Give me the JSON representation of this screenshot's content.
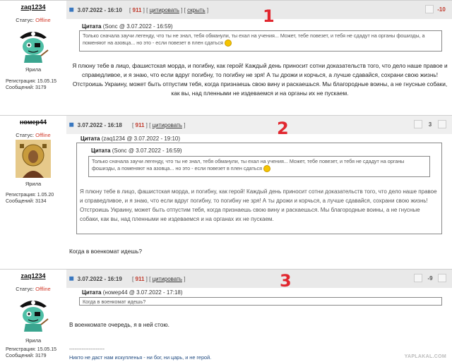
{
  "posts": [
    {
      "username": "zaq1234",
      "status_label": "Статус:",
      "status_value": "Offline",
      "rank": "Ярила",
      "reg": "Регистрация: 15.05.15",
      "msgs": "Сообщений: 3179",
      "date": "3.07.2022 - 16:10",
      "num": "911",
      "quote_link": "цитировать",
      "hide_link": "скрыть",
      "rating": "-10",
      "marker": "1",
      "quote_head_label": "Цитата",
      "quote_head_meta": "(Sonc @ 3.07.2022 - 16:59)",
      "quote_text": "Только сначала заучи легенду, что ты не знал, тебя обманули, ты ехал на учения... Может, тебе повезет, и тебя не сдадут на органы фошизды, а поменяют на азовца... но это - если повезет в плен сдаться",
      "body": "Я плюну тебе в лицо, фашистская морда, и погибну, как герой! Каждый день приносит сотни доказательств того, что дело наше правое и справедливое, и я знаю, что если вдруг погибну, то погибну не зря! А ты дрожи и корчься, а лучше сдавайся, сохрани свою жизнь! Отстроишь Украину, может быть отпустим тебя, когда признаешь свою вину и раскаешься. Мы благородные воины, а не гнусные собаки, как вы, над пленными не издеваемся и на органы их не пускаем."
    },
    {
      "username": "номер44",
      "status_label": "Статус:",
      "status_value": "Offline",
      "rank": "Ярила",
      "reg": "Регистрация: 1.05.20",
      "msgs": "Сообщений: 3134",
      "date": "3.07.2022 - 16:18",
      "num": "911",
      "quote_link": "цитировать",
      "rating": "3",
      "marker": "2",
      "outer_quote_label": "Цитата",
      "outer_quote_meta": "(zaq1234 @ 3.07.2022 - 19:10)",
      "inner_quote_label": "Цитата",
      "inner_quote_meta": "(Sonc @ 3.07.2022 - 16:59)",
      "inner_quote_text": "Только сначала заучи легенду, что ты не знал, тебя обманули, ты ехал на учения... Может, тебе повезет, и тебя не сдадут на органы фошизды, а поменяют на азовца... но это - если повезет в плен сдаться",
      "outer_quote_text": "Я плюну тебе в лицо, фашистская морда, и погибну, как герой! Каждый день приносит сотни доказательств того, что дело наше правое и справедливое, и я знаю, что если вдруг погибну, то погибну не зря! А ты дрожи и корчься, а лучше сдавайся, сохрани свою жизнь! Отстроишь Украину, может быть отпустим тебя, когда признаешь свою вину и раскаешься. Мы благородные воины, а не гнусные собаки, как вы, над пленными не издеваемся и на органах их не пускаем.",
      "body": "Когда в военкомат идешь?"
    },
    {
      "username": "zaq1234",
      "status_label": "Статус:",
      "status_value": "Offline",
      "rank": "Ярила",
      "reg": "Регистрация: 15.05.15",
      "msgs": "Сообщений: 3179",
      "date": "3.07.2022 - 16:19",
      "num": "911",
      "quote_link": "цитировать",
      "rating": "-9",
      "marker": "3",
      "quote_head_label": "Цитата",
      "quote_head_meta": "(номер44 @ 3.07.2022 - 17:18)",
      "quote_text": "Когда в военкомат идешь?",
      "body": "В военкомате очередь, я в ней стою.",
      "sig_line": "--------------------",
      "signature": "Никто не даст нам искупленья - ни бог, ни царь, и не герой."
    }
  ],
  "watermark": "YAPLAKAL.COM",
  "colors": {
    "accent_red": "#e1272f",
    "status_offline": "#d23a2a",
    "header_bg": "#e9e9e9"
  }
}
